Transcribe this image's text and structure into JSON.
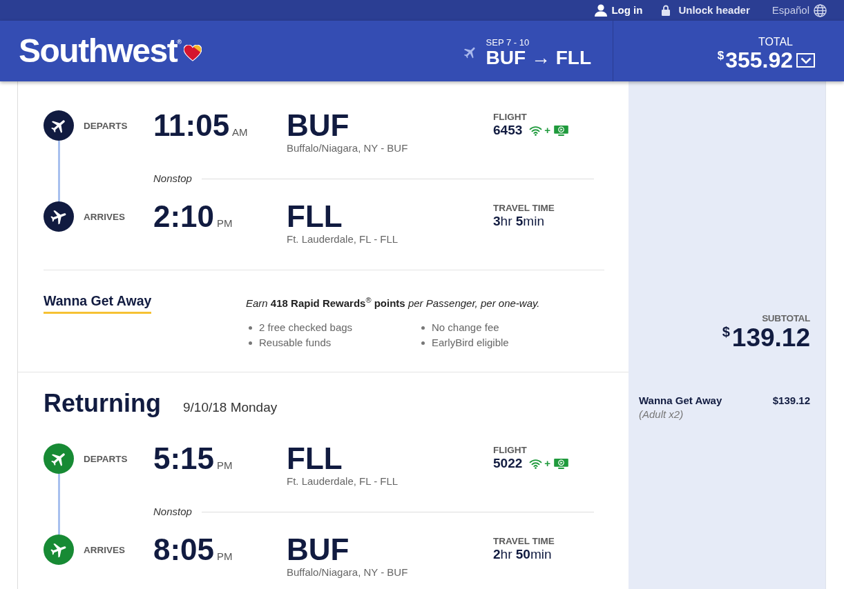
{
  "top_bar": {
    "links": [
      {
        "kind": "login",
        "label": "Log in"
      },
      {
        "kind": "lock",
        "label": "Unlock header"
      },
      {
        "kind": "language",
        "label": "Español"
      }
    ]
  },
  "header": {
    "logo": "Southwest$^{®}$",
    "trip": {
      "dates": "SEP 7 - 10",
      "route": "BUF → FLL"
    },
    "total": {
      "label": "TOTAL",
      "currency": "$",
      "amount": "355.92",
      "expanded": false
    }
  },
  "bounds": [
    {
      "color": "#111b40",
      "segments": [
        {
          "kind": "departs",
          "label": "DEPARTS",
          "time": "11:05",
          "meridiem": "AM",
          "airport": "BUF",
          "city": "Buffalo/Niagara, NY - BUF",
          "info": {
            "kind": "flight",
            "label": "FLIGHT",
            "value": "6453",
            "amenities": {
              "wifi": true,
              "joiner": "+",
              "live_tv": true
            }
          }
        },
        {
          "kind": "arrives",
          "label": "ARRIVES",
          "time": "2:10",
          "meridiem": "PM",
          "airport": "FLL",
          "city": "Ft. Lauderdale, FL - FLL",
          "info": {
            "kind": "travel_time",
            "label": "TRAVEL TIME",
            "value": "**3**hr **5**min"
          }
        }
      ],
      "stops": "Nonstop",
      "fare": {
        "name": "Wanna Get Away",
        "rewards": "*Earn* **418 Rapid Rewards**$^{®}$ **points** *per Passenger, per one-way.*",
        "features": [
          "2 free checked bags",
          "No change fee",
          "Reusable funds",
          "EarlyBird eligible"
        ]
      },
      "summary": {
        "subtotal_label": "SUBTOTAL",
        "subtotal_currency": "$",
        "subtotal": "139.12"
      }
    },
    {
      "title": "Returning",
      "date": "9/10/18 Monday",
      "color": "#178a34",
      "segments": [
        {
          "kind": "departs",
          "label": "DEPARTS",
          "time": "5:15",
          "meridiem": "PM",
          "airport": "FLL",
          "city": "Ft. Lauderdale, FL - FLL",
          "info": {
            "kind": "flight",
            "label": "FLIGHT",
            "value": "5022",
            "amenities": {
              "wifi": true,
              "joiner": "+",
              "live_tv": true
            }
          }
        },
        {
          "kind": "arrives",
          "label": "ARRIVES",
          "time": "8:05",
          "meridiem": "PM",
          "airport": "BUF",
          "city": "Buffalo/Niagara, NY - BUF",
          "info": {
            "kind": "travel_time",
            "label": "TRAVEL TIME",
            "value": "**2**hr **50**min"
          }
        }
      ],
      "stops": "Nonstop",
      "summary": {
        "fare": "Wanna Get Away",
        "price": "$139.12",
        "passengers": "(Adult x2)"
      }
    }
  ]
}
